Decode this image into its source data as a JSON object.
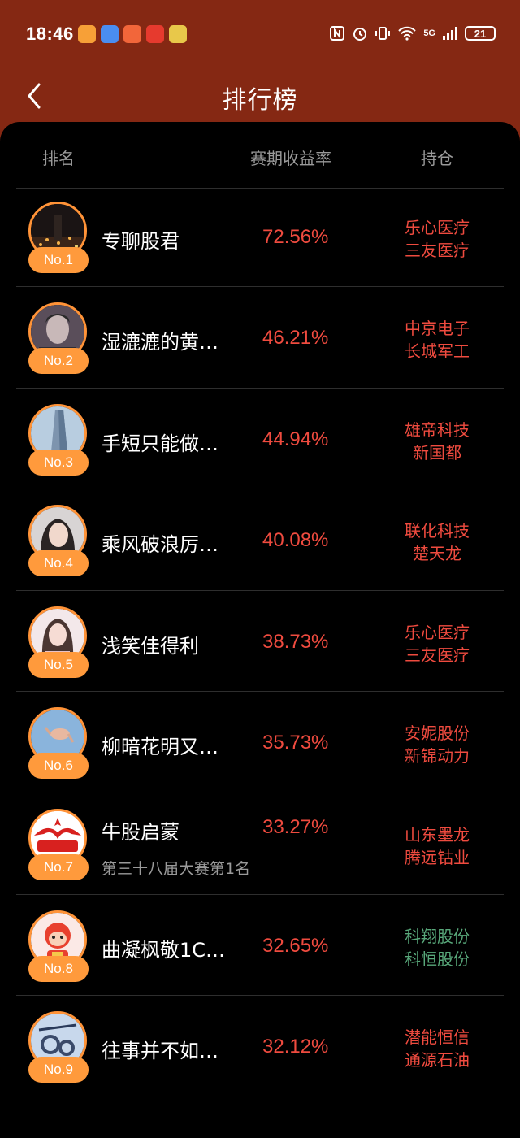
{
  "status_bar": {
    "time": "18:46",
    "battery": "21",
    "network": "5G"
  },
  "nav": {
    "title": "排行榜"
  },
  "table": {
    "headers": [
      "排名",
      "赛期收益率",
      "持仓"
    ],
    "rows": [
      {
        "rank": "No.1",
        "name": "专聊股君",
        "subtitle": "",
        "return": "72.56%",
        "holdings": [
          "乐心医疗",
          "三友医疗"
        ],
        "holding_color": "red"
      },
      {
        "rank": "No.2",
        "name": "湿漉漉的黄…",
        "subtitle": "",
        "return": "46.21%",
        "holdings": [
          "中京电子",
          "长城军工"
        ],
        "holding_color": "red"
      },
      {
        "rank": "No.3",
        "name": "手短只能做…",
        "subtitle": "",
        "return": "44.94%",
        "holdings": [
          "雄帝科技",
          "新国都"
        ],
        "holding_color": "red"
      },
      {
        "rank": "No.4",
        "name": "乘风破浪厉…",
        "subtitle": "",
        "return": "40.08%",
        "holdings": [
          "联化科技",
          "楚天龙"
        ],
        "holding_color": "red"
      },
      {
        "rank": "No.5",
        "name": "浅笑佳得利",
        "subtitle": "",
        "return": "38.73%",
        "holdings": [
          "乐心医疗",
          "三友医疗"
        ],
        "holding_color": "red"
      },
      {
        "rank": "No.6",
        "name": "柳暗花明又…",
        "subtitle": "",
        "return": "35.73%",
        "holdings": [
          "安妮股份",
          "新锦动力"
        ],
        "holding_color": "red"
      },
      {
        "rank": "No.7",
        "name": "牛股启蒙",
        "subtitle": "第三十八届大赛第1名",
        "return": "33.27%",
        "holdings": [
          "山东墨龙",
          "腾远钴业"
        ],
        "holding_color": "red"
      },
      {
        "rank": "No.8",
        "name": "曲凝枫敬1C…",
        "subtitle": "",
        "return": "32.65%",
        "holdings": [
          "科翔股份",
          "科恒股份"
        ],
        "holding_color": "green"
      },
      {
        "rank": "No.9",
        "name": "往事并不如…",
        "subtitle": "",
        "return": "32.12%",
        "holdings": [
          "潜能恒信",
          "通源石油"
        ],
        "holding_color": "red"
      }
    ]
  },
  "colors": {
    "header_bg": "#852813",
    "accent_orange": "#ff9a3c",
    "gain_red": "#ef4b3f",
    "holding_green": "#58a87a"
  }
}
